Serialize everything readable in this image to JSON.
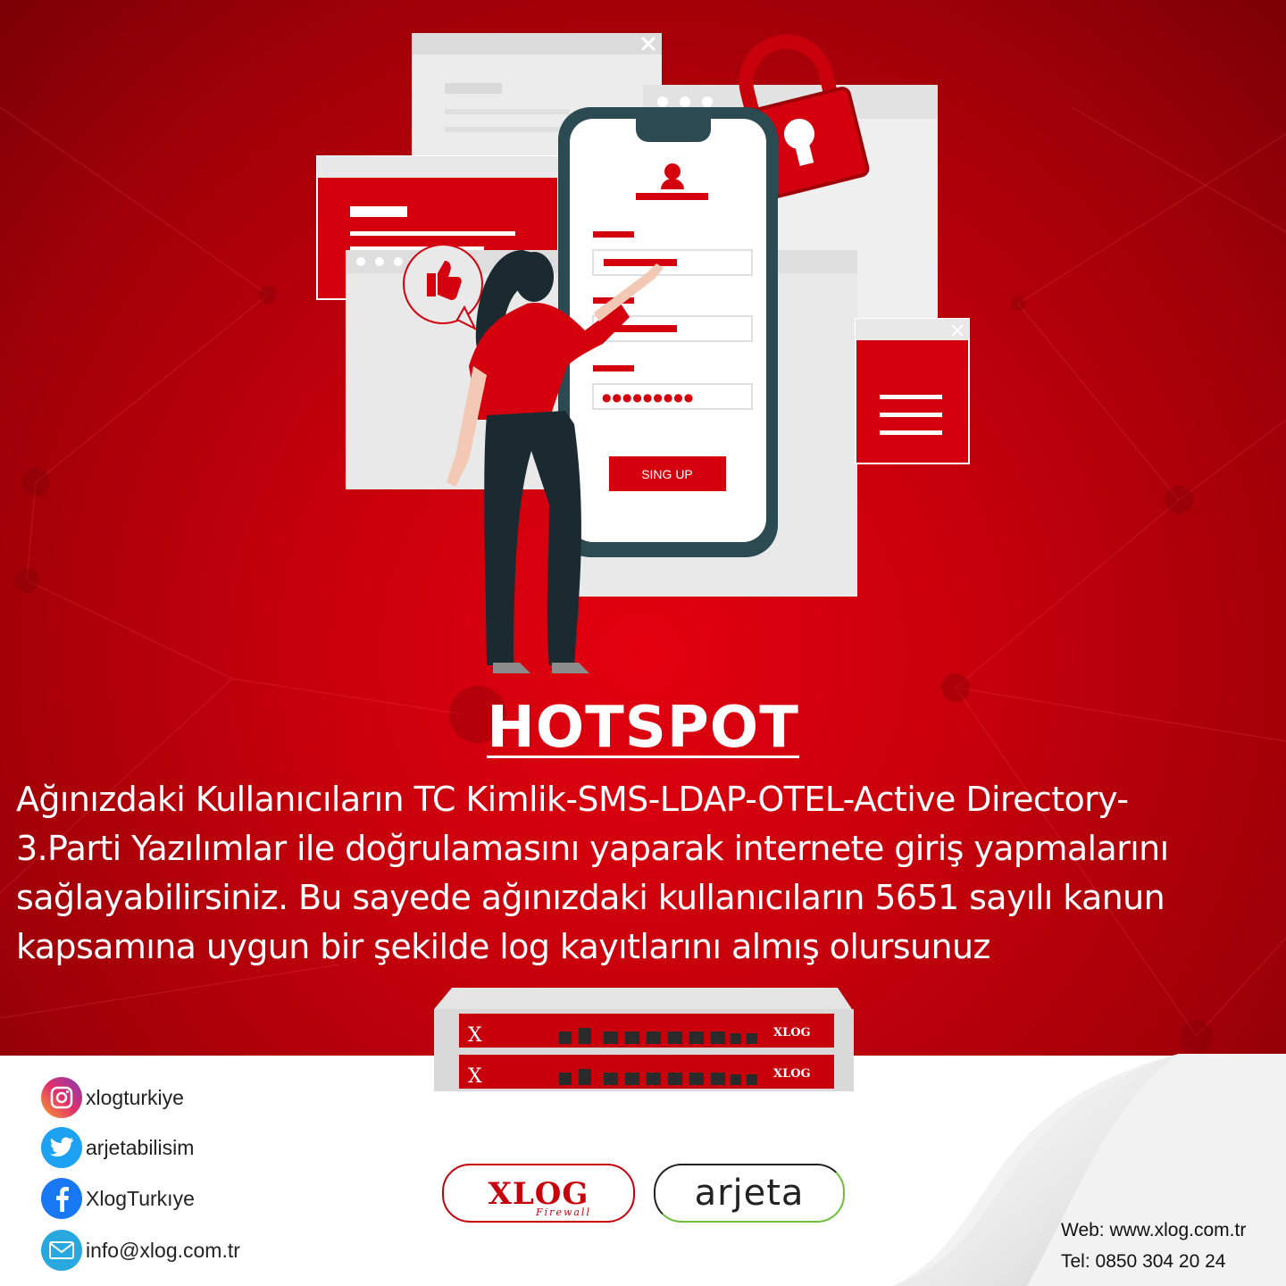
{
  "hero": {
    "title": "HOTSPOT",
    "description_lines": [
      "Ağınızdaki Kullanıcıların TC Kimlik-SMS-LDAP-OTEL-Active Directory-",
      "3.Parti Yazılımlar ile doğrulamasını yaparak internete giriş yapmalarını",
      "sağlayabilirsiniz. Bu sayede ağınızdaki kullanıcıların 5651 sayılı kanun",
      "kapsamına uygun bir şekilde log kayıtlarını almış olursunuz"
    ]
  },
  "phone_form": {
    "password_mask": "●●●●●●●●●",
    "signup_label": "SING UP"
  },
  "social": {
    "instagram": "xlogturkiye",
    "twitter": "arjetabilisim",
    "facebook": "XlogTurkıye",
    "email": "info@xlog.com.tr"
  },
  "logos": {
    "xlog_text": "XLOG",
    "xlog_sub": "Firewall",
    "arjeta_text": "arjeta"
  },
  "contact": {
    "web": "Web: www.xlog.com.tr",
    "tel": "Tel: 0850 304 20 24"
  },
  "colors": {
    "brand_red": "#d5000d",
    "dark_red": "#8a0006",
    "phone_frame": "#2c4a52"
  }
}
